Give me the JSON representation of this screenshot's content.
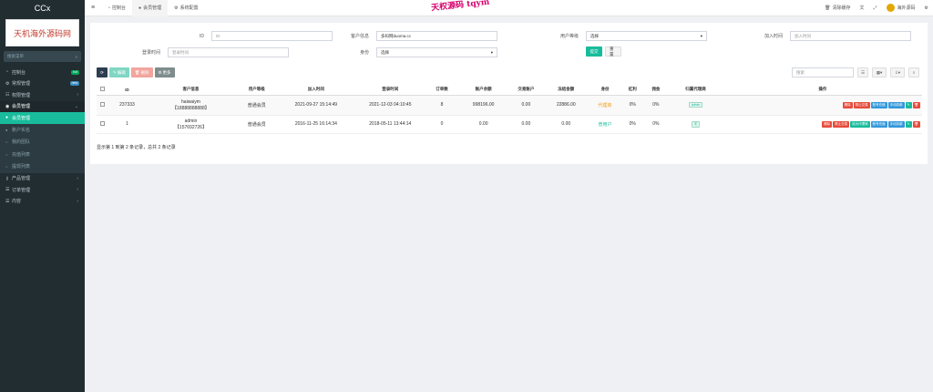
{
  "brand": "CCx",
  "logo_text": "天机海外源码网",
  "watermark": "天权源码 tqym",
  "sidebar": {
    "search_placeholder": "搜索菜单",
    "items": [
      {
        "label": "控制台",
        "icon": "speedometer-icon",
        "badge": "hot",
        "badge_color": "#00a65a"
      },
      {
        "label": "常规管理",
        "icon": "gear-icon",
        "badge": "new",
        "badge_color": "#3c8dbc"
      },
      {
        "label": "权限管理",
        "icon": "users-icon"
      },
      {
        "label": "会员管理",
        "icon": "user-circle-icon"
      }
    ],
    "subitems": [
      {
        "label": "会员管理",
        "icon": "user-icon",
        "active": true
      },
      {
        "label": "账户实名",
        "icon": "user-icon"
      },
      {
        "label": "我的团队",
        "icon": "circle-icon"
      },
      {
        "label": "充值列表",
        "icon": "circle-icon"
      },
      {
        "label": "提现列表",
        "icon": "circle-icon"
      }
    ],
    "bottom_items": [
      {
        "label": "产品管理",
        "icon": "key-icon"
      },
      {
        "label": "订单管理",
        "icon": "list-icon"
      },
      {
        "label": "内容",
        "icon": "list-icon"
      }
    ]
  },
  "topbar": {
    "tabs": [
      {
        "label": "控制台",
        "icon": "dashboard-icon"
      },
      {
        "label": "会员管理",
        "icon": "user-icon",
        "active": true
      },
      {
        "label": "系统配置",
        "icon": "gear-icon"
      }
    ],
    "right": {
      "clear_cache": "清除缓存",
      "user": "海外源码"
    }
  },
  "search_form": {
    "id_label": "ID",
    "id_placeholder": "ID",
    "customer_label": "客户信息",
    "customer_value": "多码网duoma.cc",
    "level_label": "用户等级",
    "level_value": "选择",
    "join_label": "加入时间",
    "join_placeholder": "加入时间",
    "login_label": "登录时间",
    "login_placeholder": "登录时间",
    "identity_label": "身份",
    "identity_value": "选择",
    "submit": "提交",
    "reset": "重置"
  },
  "toolbar": {
    "edit": "编辑",
    "delete": "删除",
    "more": "更多",
    "search_placeholder": "搜索"
  },
  "table": {
    "headers": [
      "ID",
      "客户信息",
      "用户等级",
      "加入时间",
      "登录时间",
      "订单数",
      "账户余额",
      "交易账户",
      "冻结金额",
      "身份",
      "杠利",
      "佣金",
      "归属代理商",
      "操作"
    ],
    "rows": [
      {
        "id": "237333",
        "name": "haiwaiym",
        "phone": "【18888888888】",
        "level": "普通会员",
        "join": "2021-09-27 15:14:49",
        "login": "2021-12-03 04:10:45",
        "orders": "8",
        "balance": "998196.00",
        "trade": "0.00",
        "frozen": "22886.00",
        "identity": "代理商",
        "identity_color": "#f39c12",
        "lever": "0%",
        "commission": "0%",
        "agent": "admin",
        "ops": [
          {
            "label": "删除",
            "color": "#e74c3c"
          },
          {
            "label": "禁止交易",
            "color": "#e74c3c"
          },
          {
            "label": "账号充值",
            "color": "#3498db"
          },
          {
            "label": "手动扣款",
            "color": "#3498db"
          }
        ]
      },
      {
        "id": "1",
        "name": "admin",
        "phone": "【157692726】",
        "level": "普通会员",
        "join": "2016-11-25 16:14:34",
        "login": "2018-05-11 13:44:14",
        "orders": "0",
        "balance": "0.00",
        "trade": "0.00",
        "frozen": "0.00",
        "identity": "普用户",
        "identity_color": "#18bc9c",
        "lever": "0%",
        "commission": "0%",
        "agent": "无",
        "ops": [
          {
            "label": "删除",
            "color": "#e74c3c"
          },
          {
            "label": "禁止交易",
            "color": "#e74c3c"
          },
          {
            "label": "设为代理商",
            "color": "#18bc9c"
          },
          {
            "label": "账号充值",
            "color": "#3498db"
          },
          {
            "label": "手动扣款",
            "color": "#3498db"
          }
        ]
      }
    ]
  },
  "footer": "显示第 1 到第 2 条记录，总共 2 条记录"
}
